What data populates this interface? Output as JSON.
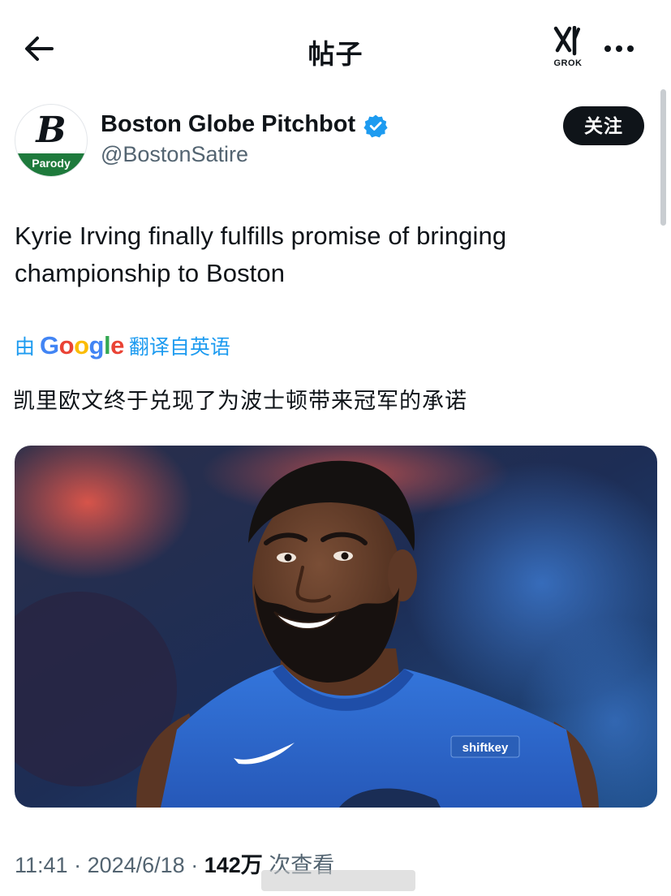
{
  "header": {
    "title": "帖子",
    "grok_label": "GROK"
  },
  "author": {
    "name": "Boston Globe Pitchbot",
    "handle": "@BostonSatire",
    "avatar_letter": "B",
    "avatar_badge": "Parody",
    "verified": true
  },
  "follow_label": "关注",
  "tweet": {
    "text": "Kyrie Irving finally fulfills promise of bringing championship to Boston",
    "translate_prefix": "由",
    "translate_brand": "Google",
    "translate_suffix": "翻译自英语",
    "translated_text": "凯里欧文终于兑现了为波士顿带来冠军的承诺"
  },
  "media": {
    "jersey_sponsor": "shiftkey"
  },
  "meta": {
    "time": "11:41",
    "sep1": " · ",
    "date": "2024/6/18",
    "sep2": " · ",
    "views_count": "142万",
    "views_label": " 次查看"
  },
  "colors": {
    "accent": "#1d9bf0",
    "text_primary": "#0f1419",
    "text_secondary": "#536471",
    "verified": "#1d9bf0",
    "parody_band": "#1e7a3c",
    "jersey_blue": "#2f6fd6"
  },
  "icons": {
    "back": "arrow-left-icon",
    "grok": "grok-icon",
    "more": "more-horizontal-icon",
    "verified": "verified-badge-icon"
  }
}
